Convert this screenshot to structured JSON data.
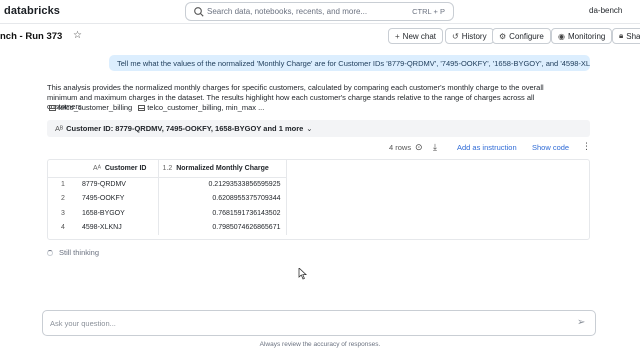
{
  "app": {
    "logo": "databricks",
    "user": "da-bench"
  },
  "search": {
    "placeholder": "Search data, notebooks, recents, and more...",
    "shortcut": "CTRL + P"
  },
  "header": {
    "title": "nch - Run 373",
    "buttons": {
      "new_chat": "New chat",
      "history": "History",
      "configure": "Configure",
      "monitoring": "Monitoring",
      "share": "Sha"
    }
  },
  "conversation": {
    "question": "Tell me what the values of the normalized 'Monthly Charge' are for Customer IDs '8779-QRDMV', '7495-OOKFY', '1658-BYGOY', and '4598-XLKNJ'?",
    "answer": "This analysis provides the normalized monthly charges for specific customers, calculated by comparing each customer's monthly charge to the overall minimum and maximum charges in the dataset. The results highlight how each customer's charge stands relative to the range of charges across all customers.",
    "tables": [
      "telco_customer_billing",
      "telco_customer_billing, min_max ..."
    ],
    "filter": "Customer ID: 8779-QRDMV, 7495-OOKFY, 1658-BYGOY and 1 more",
    "thinking": "Still thinking"
  },
  "results": {
    "row_count": "4 rows",
    "add_instruction": "Add as instruction",
    "show_code": "Show code",
    "columns": [
      {
        "type": "Aᴬ",
        "label": "Customer ID"
      },
      {
        "type": "1.2",
        "label": "Normalized Monthly Charge"
      }
    ],
    "rows": [
      {
        "index": "1",
        "customer_id": "8779-QRDMV",
        "value": "0.21293533856595925"
      },
      {
        "index": "2",
        "customer_id": "7495-OOKFY",
        "value": "0.6208955375709344"
      },
      {
        "index": "3",
        "customer_id": "1658-BYGOY",
        "value": "0.7681591736143502"
      },
      {
        "index": "4",
        "customer_id": "4598-XLKNJ",
        "value": "0.7985074626865671"
      }
    ]
  },
  "input": {
    "placeholder": "Ask your question...",
    "disclaimer": "Always review the accuracy of responses."
  },
  "colors": {
    "accent_link": "#2f6bd6",
    "question_bubble": "#dceefe"
  }
}
